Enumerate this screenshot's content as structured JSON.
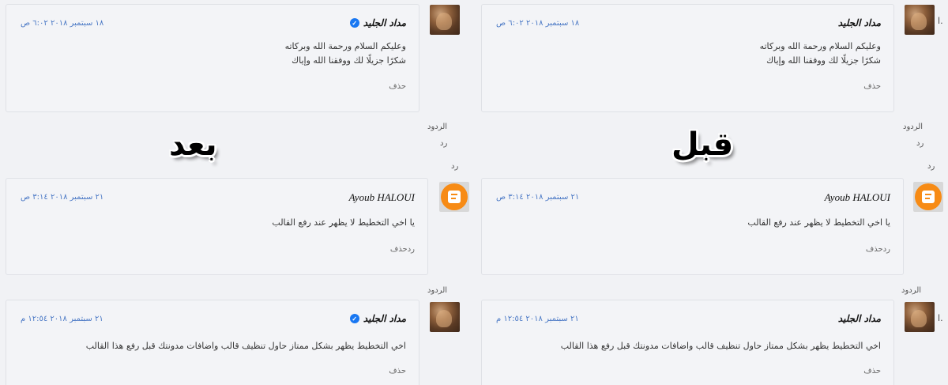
{
  "labels": {
    "before": "قبل",
    "after": "بعد"
  },
  "thread": {
    "replies_heading": "الردود",
    "reply": "رد"
  },
  "comments": [
    {
      "author": "مداد الجليد",
      "date": "١٨ سبتمبر ٢٠١٨ ٦:٠٢ ص",
      "line1": "وعليكم السلام ورحمة الله وبركاته",
      "line2": "شكرًا جزيلًا لك ووفقنا الله وإياك",
      "action": "حذف"
    },
    {
      "author": "Ayoub HALOUI",
      "date": "٢١ سبتمبر ٢٠١٨ ٣:١٤ ص",
      "line1": "يا اخي التخطيط لا يظهر عند رفع القالب",
      "action": "ردحذف"
    },
    {
      "author": "مداد الجليد",
      "date": "٢١ سبتمبر ٢٠١٨ ١٢:٥٤ م",
      "line1": "اخي التخطيط يظهر بشكل ممتاز حاول تنظيف قالب واضافات مدونتك قبل رفع هذا القالب",
      "action": "حذف"
    }
  ],
  "edge_char": "ا."
}
